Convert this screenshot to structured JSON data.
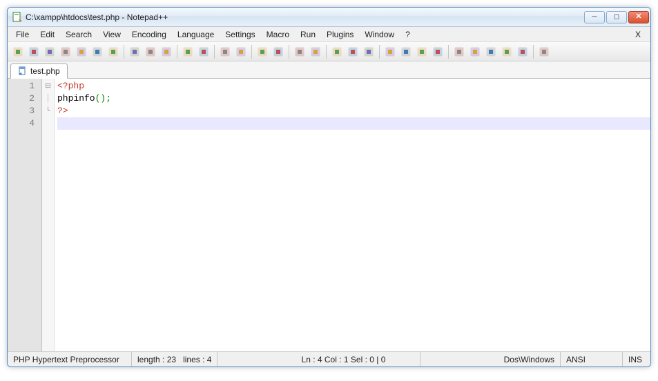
{
  "window": {
    "title": "C:\\xampp\\htdocs\\test.php - Notepad++"
  },
  "menu": {
    "items": [
      "File",
      "Edit",
      "Search",
      "View",
      "Encoding",
      "Language",
      "Settings",
      "Macro",
      "Run",
      "Plugins",
      "Window",
      "?"
    ],
    "right": "X"
  },
  "toolbar": {
    "buttons": [
      {
        "name": "new-file-icon",
        "title": "New"
      },
      {
        "name": "open-file-icon",
        "title": "Open"
      },
      {
        "name": "save-icon",
        "title": "Save"
      },
      {
        "name": "save-all-icon",
        "title": "Save All"
      },
      {
        "name": "close-icon",
        "title": "Close"
      },
      {
        "name": "close-all-icon",
        "title": "Close All"
      },
      {
        "name": "print-icon",
        "title": "Print"
      },
      {
        "sep": true
      },
      {
        "name": "cut-icon",
        "title": "Cut"
      },
      {
        "name": "copy-icon",
        "title": "Copy"
      },
      {
        "name": "paste-icon",
        "title": "Paste"
      },
      {
        "sep": true
      },
      {
        "name": "undo-icon",
        "title": "Undo"
      },
      {
        "name": "redo-icon",
        "title": "Redo"
      },
      {
        "sep": true
      },
      {
        "name": "find-icon",
        "title": "Find"
      },
      {
        "name": "replace-icon",
        "title": "Replace"
      },
      {
        "sep": true
      },
      {
        "name": "zoom-in-icon",
        "title": "Zoom In"
      },
      {
        "name": "zoom-out-icon",
        "title": "Zoom Out"
      },
      {
        "sep": true
      },
      {
        "name": "sync-v-icon",
        "title": "Sync Vertical"
      },
      {
        "name": "sync-h-icon",
        "title": "Sync Horizontal"
      },
      {
        "sep": true
      },
      {
        "name": "wrap-icon",
        "title": "Word Wrap"
      },
      {
        "name": "all-chars-icon",
        "title": "Show All Characters"
      },
      {
        "name": "indent-guide-icon",
        "title": "Indent Guide"
      },
      {
        "sep": true
      },
      {
        "name": "lang-udl-icon",
        "title": "User Language"
      },
      {
        "name": "doc-map-icon",
        "title": "Doc Map"
      },
      {
        "name": "func-list-icon",
        "title": "Function List"
      },
      {
        "name": "folder-icon",
        "title": "Folder as Workspace"
      },
      {
        "sep": true
      },
      {
        "name": "record-icon",
        "title": "Start Recording"
      },
      {
        "name": "stop-record-icon",
        "title": "Stop Recording"
      },
      {
        "name": "play-icon",
        "title": "Play"
      },
      {
        "name": "play-multi-icon",
        "title": "Run Multiple"
      },
      {
        "name": "save-macro-icon",
        "title": "Save Macro"
      },
      {
        "sep": true
      },
      {
        "name": "spell-icon",
        "title": "Spell Check"
      }
    ]
  },
  "tabs": [
    {
      "label": "test.php",
      "active": true
    }
  ],
  "code": {
    "lines": [
      {
        "n": 1,
        "fold": "minus",
        "tokens": [
          {
            "cls": "tok-open",
            "t": "<?php"
          }
        ]
      },
      {
        "n": 2,
        "fold": "pipe",
        "tokens": [
          {
            "cls": "tok-func",
            "t": "phpinfo"
          },
          {
            "cls": "tok-punct",
            "t": "();"
          }
        ]
      },
      {
        "n": 3,
        "fold": "end",
        "tokens": [
          {
            "cls": "tok-open",
            "t": "?>"
          }
        ]
      },
      {
        "n": 4,
        "fold": "",
        "tokens": [],
        "current": true
      }
    ]
  },
  "status": {
    "lang": "PHP Hypertext Preprocessor",
    "length_label": "length : 23",
    "lines_label": "lines : 4",
    "pos": "Ln : 4   Col : 1   Sel : 0 | 0",
    "eol": "Dos\\Windows",
    "encoding": "ANSI",
    "mode": "INS"
  }
}
